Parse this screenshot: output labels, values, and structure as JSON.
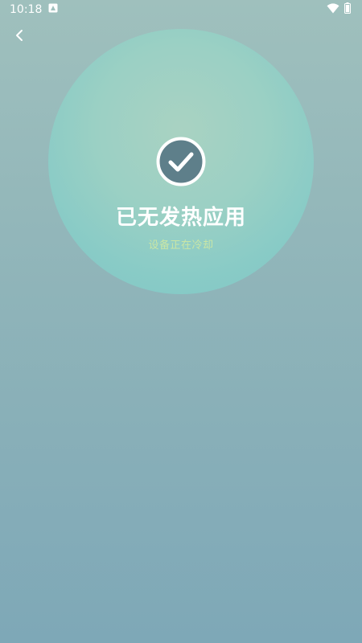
{
  "status_bar": {
    "time": "10:18",
    "notification_icon": "a-badge-icon",
    "wifi_icon": "wifi-icon",
    "battery_icon": "battery-icon"
  },
  "nav": {
    "back_icon": "chevron-left-icon"
  },
  "result": {
    "icon": "check-circle-icon",
    "title": "已无发热应用",
    "subtitle": "设备正在冷却"
  },
  "colors": {
    "background_top": "#9fc0bd",
    "background_bottom": "#7ea8b7",
    "circle": "#89cbc6",
    "check_fill": "#5e7f8a",
    "subtitle": "#c9e6a6"
  }
}
